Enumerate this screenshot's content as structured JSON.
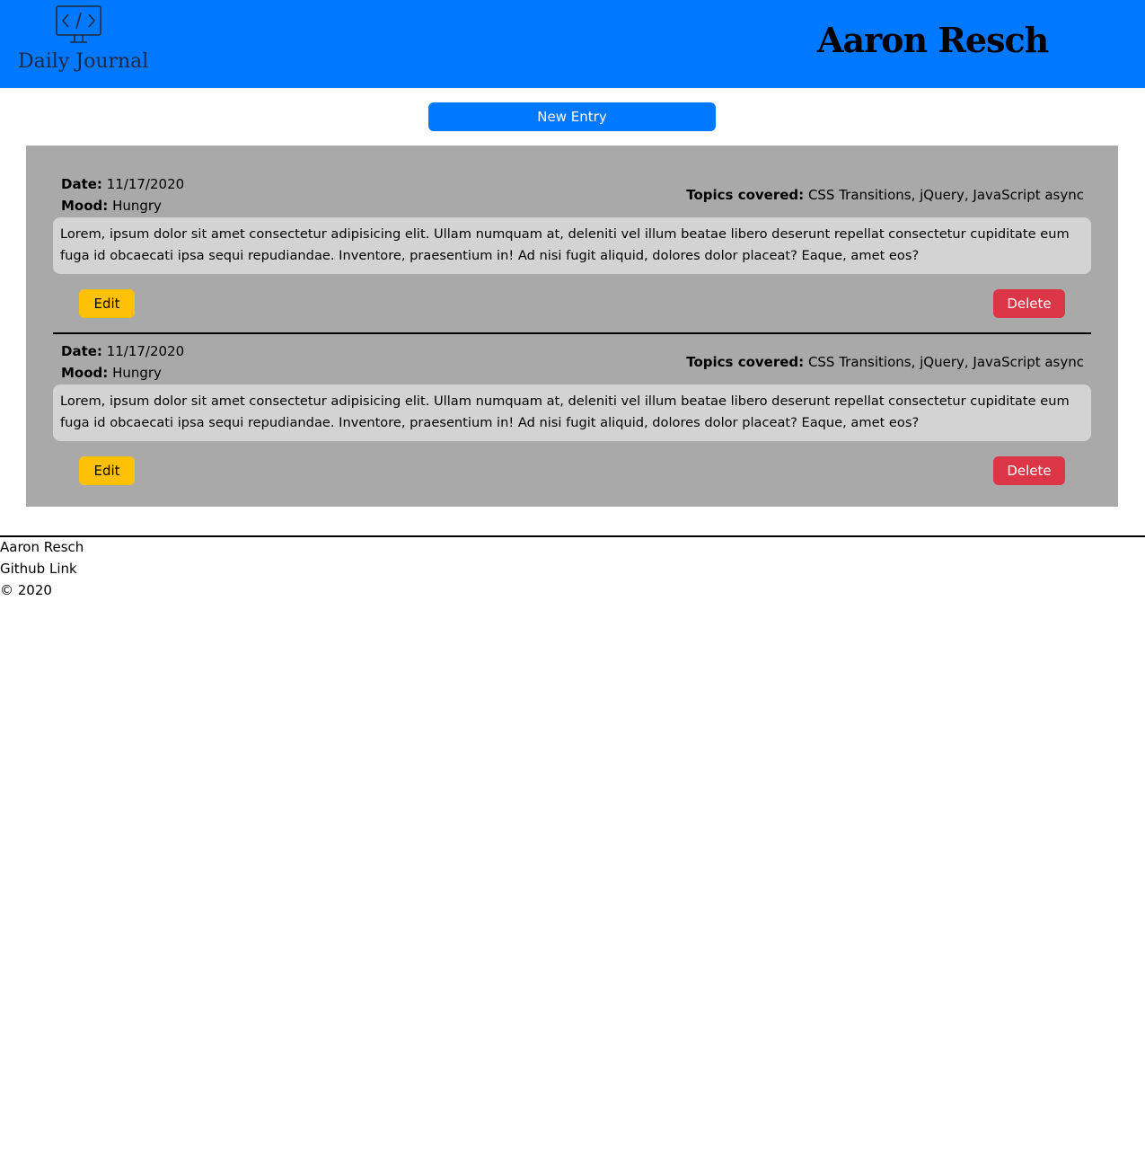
{
  "header": {
    "logo_text": "Daily Journal",
    "logo_icon": "code-monitor-icon",
    "title": "Aaron Resch",
    "background": "#0078ff"
  },
  "toolbar": {
    "new_entry_label": "New Entry"
  },
  "entries": [
    {
      "date_label": "Date:",
      "date": "11/17/2020",
      "mood_label": "Mood:",
      "mood": "Hungry",
      "topics_label": "Topics covered:",
      "topics": "CSS Transitions, jQuery, JavaScript async",
      "body": "Lorem, ipsum dolor sit amet consectetur adipisicing elit. Ullam numquam at, deleniti vel illum beatae libero deserunt repellat consectetur cupiditate eum fuga id obcaecati ipsa sequi repudiandae. Inventore, praesentium in! Ad nisi fugit aliquid, dolores dolor placeat? Eaque, amet eos?",
      "edit_label": "Edit",
      "delete_label": "Delete"
    },
    {
      "date_label": "Date:",
      "date": "11/17/2020",
      "mood_label": "Mood:",
      "mood": "Hungry",
      "topics_label": "Topics covered:",
      "topics": "CSS Transitions, jQuery, JavaScript async",
      "body": "Lorem, ipsum dolor sit amet consectetur adipisicing elit. Ullam numquam at, deleniti vel illum beatae libero deserunt repellat consectetur cupiditate eum fuga id obcaecati ipsa sequi repudiandae. Inventore, praesentium in! Ad nisi fugit aliquid, dolores dolor placeat? Eaque, amet eos?",
      "edit_label": "Edit",
      "delete_label": "Delete"
    }
  ],
  "footer": {
    "name": "Aaron Resch",
    "github_link": "Github Link",
    "copyright": "© 2020"
  },
  "colors": {
    "primary": "#0078ff",
    "edit": "#ffc107",
    "delete": "#dc3545",
    "entries_bg": "#a9a9a9",
    "body_bg": "#d3d3d3"
  }
}
